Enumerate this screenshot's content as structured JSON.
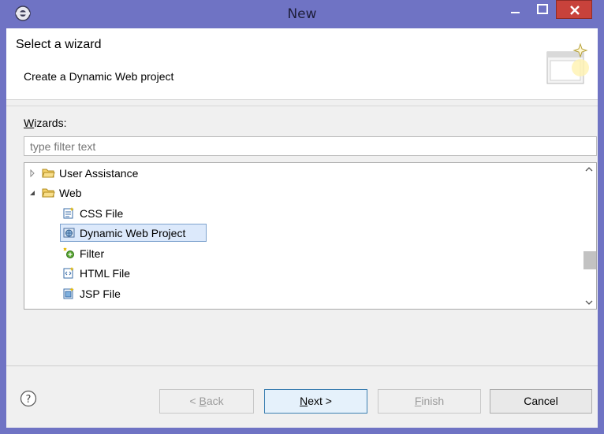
{
  "window": {
    "title": "New"
  },
  "header": {
    "title": "Select a wizard",
    "description": "Create a Dynamic Web project"
  },
  "wizards": {
    "label": "Wizards:",
    "filter_placeholder": "type filter text",
    "items": [
      {
        "label": "User Assistance",
        "icon": "folder-icon",
        "expanded": false
      },
      {
        "label": "Web",
        "icon": "folder-open-icon",
        "expanded": true
      },
      {
        "label": "CSS File",
        "icon": "css-file-icon"
      },
      {
        "label": "Dynamic Web Project",
        "icon": "web-project-icon",
        "selected": true
      },
      {
        "label": "Filter",
        "icon": "filter-icon"
      },
      {
        "label": "HTML File",
        "icon": "html-file-icon"
      },
      {
        "label": "JSP File",
        "icon": "jsp-file-icon"
      }
    ]
  },
  "buttons": {
    "back_prefix": "< ",
    "back_mnemonic": "B",
    "back_rest": "ack",
    "next_mnemonic": "N",
    "next_rest": "ext >",
    "finish_mnemonic": "F",
    "finish_rest": "inish",
    "cancel": "Cancel"
  },
  "colors": {
    "title_bar": "#6f73c4",
    "close_button": "#c8423b",
    "selection": "#dce9fb"
  }
}
